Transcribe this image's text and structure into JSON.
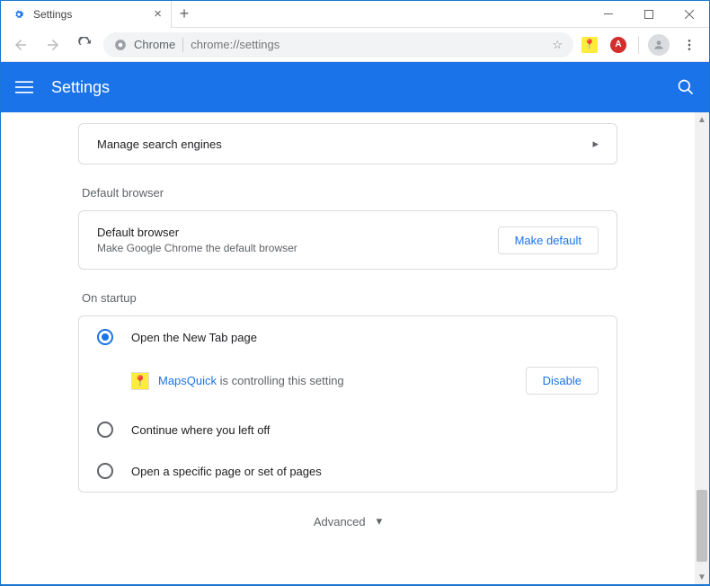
{
  "tab": {
    "title": "Settings"
  },
  "omnibox": {
    "scheme_label": "Chrome",
    "url": "chrome://settings"
  },
  "header": {
    "title": "Settings"
  },
  "manage_engines": {
    "label": "Manage search engines"
  },
  "default_browser": {
    "section": "Default browser",
    "title": "Default browser",
    "subtitle": "Make Google Chrome the default browser",
    "button": "Make default"
  },
  "startup": {
    "section": "On startup",
    "opt_newtab": "Open the New Tab page",
    "opt_continue": "Continue where you left off",
    "opt_specific": "Open a specific page or set of pages",
    "extension_name": "MapsQuick",
    "extension_msg": "is controlling this setting",
    "disable": "Disable"
  },
  "advanced": {
    "label": "Advanced"
  },
  "ext_badge": "A"
}
